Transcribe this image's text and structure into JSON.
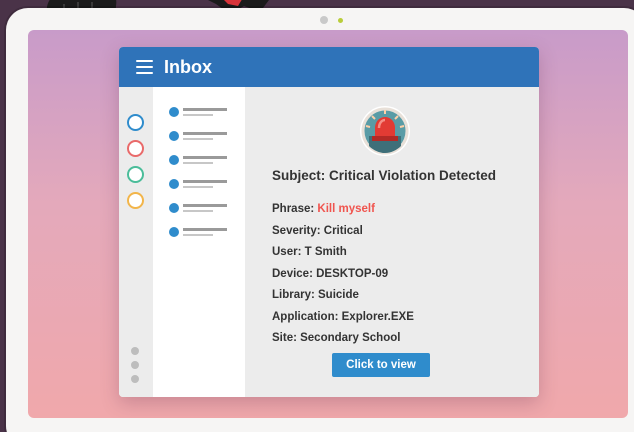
{
  "window": {
    "title": "Inbox",
    "menu_icon": "hamburger-menu-icon"
  },
  "rail": {
    "circle_colors": [
      "#2f8ccc",
      "#e96a6a",
      "#4bbd9a",
      "#f2b54a"
    ]
  },
  "message": {
    "avatar_icon": "alarm-siren-icon",
    "subject": "Subject: Critical Violation Detected",
    "phrase_label": "Phrase: ",
    "phrase_value": "Kill myself",
    "severity": "Severity: Critical",
    "user": "User: T Smith",
    "device": "Device: DESKTOP-09",
    "library": "Library: Suicide",
    "application": "Application: Explorer.EXE",
    "site": "Site: Secondary School",
    "button_label": "Click to view"
  },
  "colors": {
    "titlebar": "#2f73b9",
    "accent": "#2f8ccc",
    "alert": "#f0554f"
  }
}
